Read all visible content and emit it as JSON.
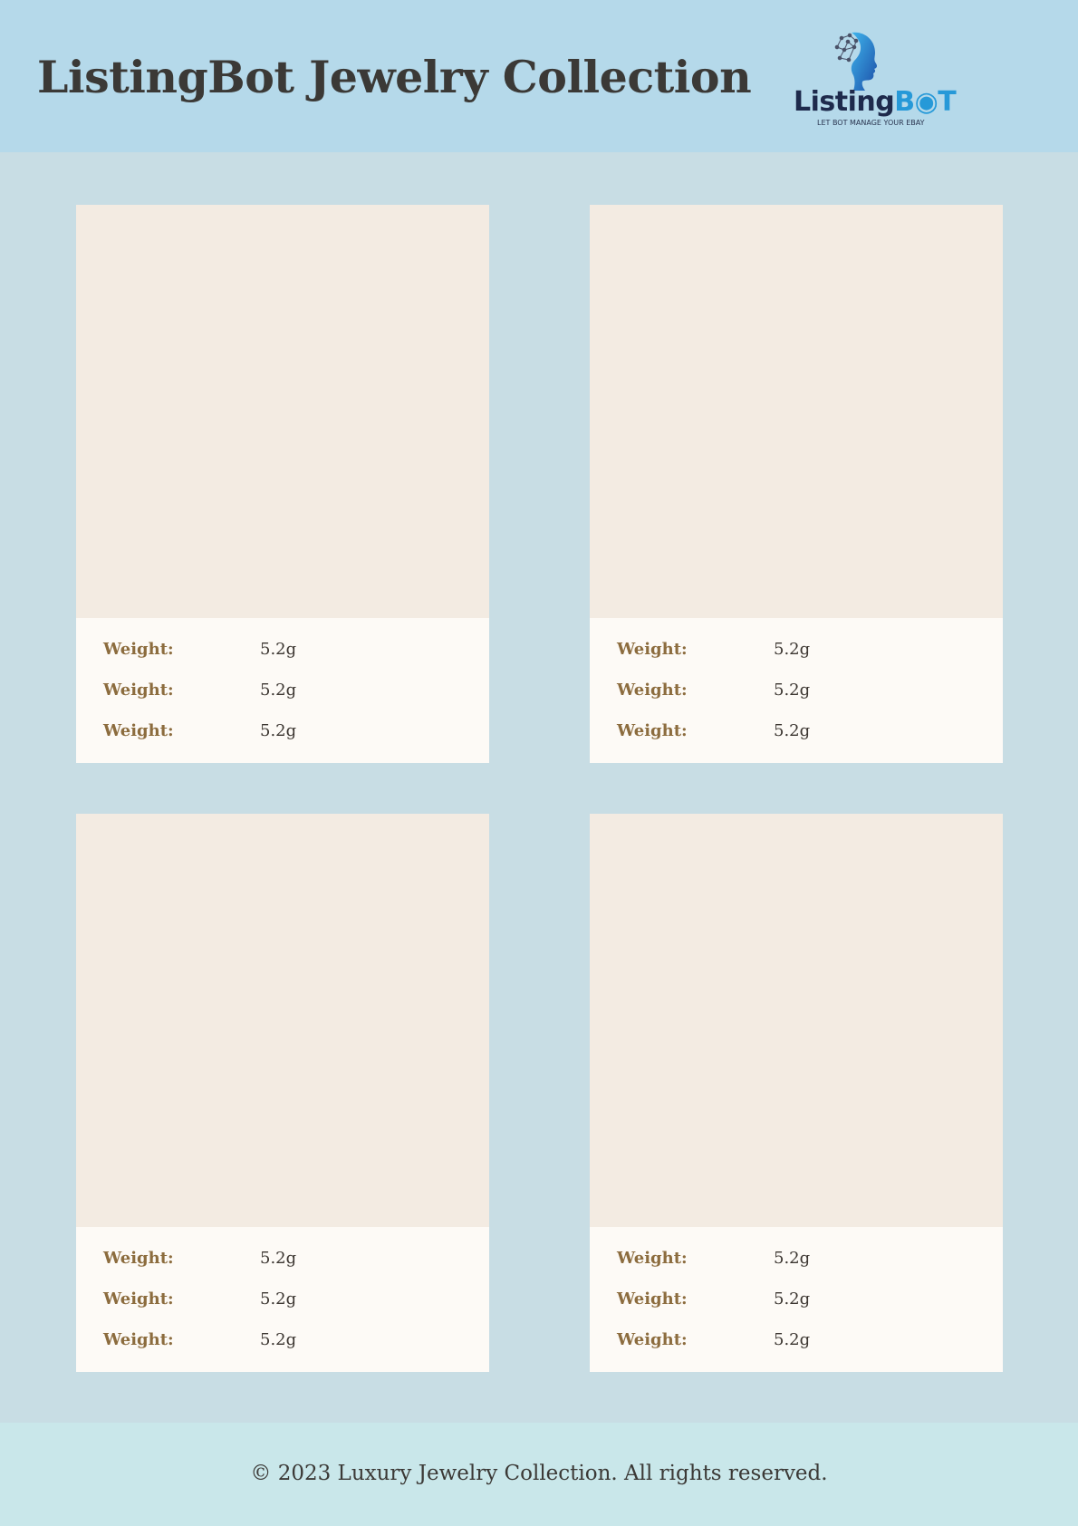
{
  "header": {
    "title": "ListingBot Jewelry Collection",
    "logo": {
      "word_main": "Listing",
      "word_accent_a": "B",
      "word_accent_b": "T",
      "tagline": "LET BOT MANAGE YOUR EBAY",
      "icon": "robot-head-icon"
    }
  },
  "products": [
    {
      "image": "product-image-placeholder",
      "specs": [
        {
          "label": "Weight:",
          "value": "5.2g"
        },
        {
          "label": "Weight:",
          "value": "5.2g"
        },
        {
          "label": "Weight:",
          "value": "5.2g"
        }
      ]
    },
    {
      "image": "product-image-placeholder",
      "specs": [
        {
          "label": "Weight:",
          "value": "5.2g"
        },
        {
          "label": "Weight:",
          "value": "5.2g"
        },
        {
          "label": "Weight:",
          "value": "5.2g"
        }
      ]
    },
    {
      "image": "product-image-placeholder",
      "specs": [
        {
          "label": "Weight:",
          "value": "5.2g"
        },
        {
          "label": "Weight:",
          "value": "5.2g"
        },
        {
          "label": "Weight:",
          "value": "5.2g"
        }
      ]
    },
    {
      "image": "product-image-placeholder",
      "specs": [
        {
          "label": "Weight:",
          "value": "5.2g"
        },
        {
          "label": "Weight:",
          "value": "5.2g"
        },
        {
          "label": "Weight:",
          "value": "5.2g"
        }
      ]
    }
  ],
  "footer": {
    "text": "© 2023 Luxury Jewelry Collection. All rights reserved."
  },
  "colors": {
    "header_bg": "#b5d9ea",
    "page_bg": "#c8dde4",
    "footer_bg": "#c9e7ea",
    "label_gold": "#8c6c3e",
    "logo_blue": "#2699d8",
    "logo_navy": "#1e2a4c"
  }
}
